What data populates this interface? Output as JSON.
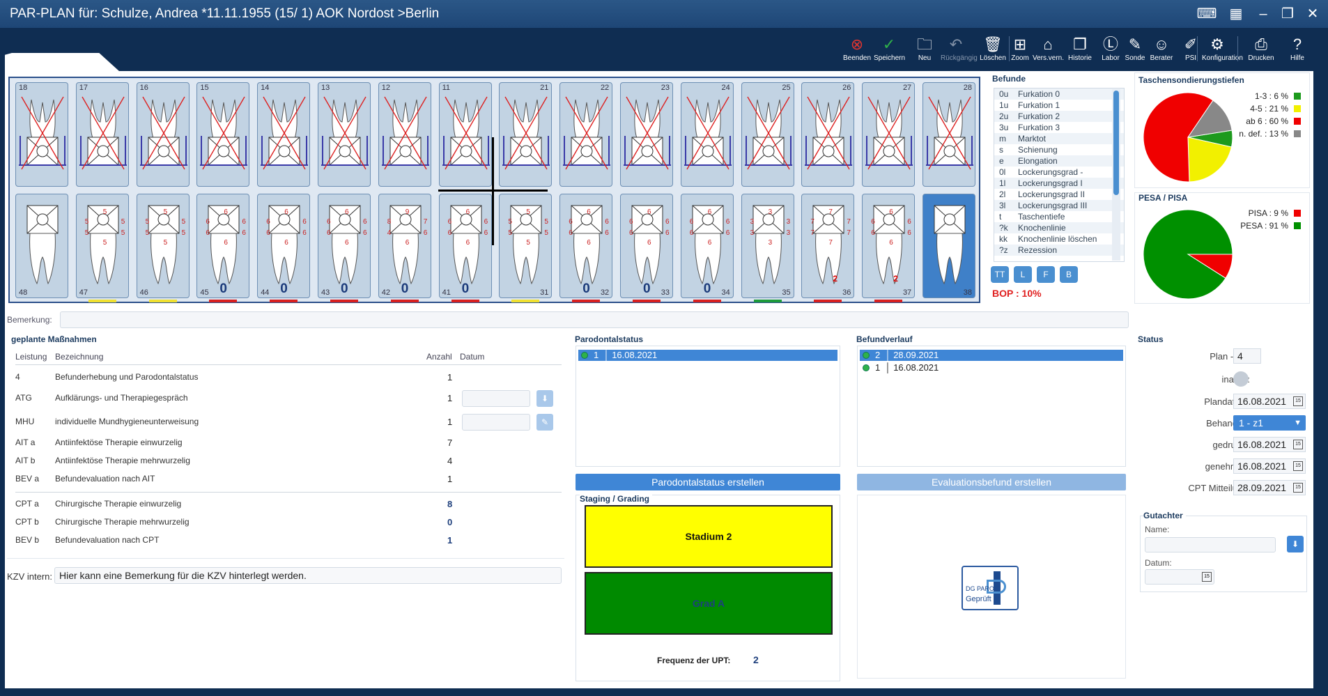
{
  "window": {
    "title": "PAR-PLAN für: Schulze, Andrea *11.11.1955 (15/  1) AOK Nordost >Berlin"
  },
  "toolbar": [
    {
      "label": "Beenden",
      "icon": "close-circle-icon",
      "color": "#e0342f"
    },
    {
      "label": "Speichern",
      "icon": "check-circle-icon",
      "color": "#2fb24a"
    },
    {
      "label": "Neu",
      "icon": "new-folder-icon",
      "color": "#ffffff"
    },
    {
      "label": "Rückgängig",
      "icon": "undo-icon",
      "color": "#7f8fa5"
    },
    {
      "label": "Löschen",
      "icon": "trash-icon",
      "color": "#ffffff"
    },
    {
      "label": "Zoom",
      "icon": "zoom-icon",
      "color": "#ffffff"
    },
    {
      "label": "Vers.vern.",
      "icon": "tag-icon",
      "color": "#ffffff"
    },
    {
      "label": "Historie",
      "icon": "copy-icon",
      "color": "#ffffff"
    },
    {
      "label": "Labor",
      "icon": "labor-icon",
      "color": "#ffffff"
    },
    {
      "label": "Sonde",
      "icon": "probe-icon",
      "color": "#ffffff"
    },
    {
      "label": "Berater",
      "icon": "user-gear-icon",
      "color": "#ffffff"
    },
    {
      "label": "PSI",
      "icon": "pencil-icon",
      "color": "#ffffff"
    },
    {
      "label": "Konfiguration",
      "icon": "gear-icon",
      "color": "#ffffff"
    },
    {
      "label": "Drucken",
      "icon": "printer-icon",
      "color": "#ffffff"
    },
    {
      "label": "Hilfe",
      "icon": "help-icon",
      "color": "#ffffff"
    }
  ],
  "teeth_upper": [
    {
      "num": "18",
      "xed": true,
      "bar": ""
    },
    {
      "num": "17",
      "xed": true,
      "bar": ""
    },
    {
      "num": "16",
      "xed": true,
      "bar": ""
    },
    {
      "num": "15",
      "xed": true,
      "bar": ""
    },
    {
      "num": "14",
      "xed": true,
      "bar": ""
    },
    {
      "num": "13",
      "xed": true,
      "bar": ""
    },
    {
      "num": "12",
      "xed": true,
      "bar": ""
    },
    {
      "num": "11",
      "xed": true,
      "bar": ""
    },
    {
      "num": "21",
      "xed": true,
      "bar": ""
    },
    {
      "num": "22",
      "xed": true,
      "bar": ""
    },
    {
      "num": "23",
      "xed": true,
      "bar": ""
    },
    {
      "num": "24",
      "xed": true,
      "bar": ""
    },
    {
      "num": "25",
      "xed": true,
      "bar": ""
    },
    {
      "num": "26",
      "xed": true,
      "bar": ""
    },
    {
      "num": "27",
      "xed": true,
      "bar": ""
    },
    {
      "num": "28",
      "xed": true,
      "bar": ""
    }
  ],
  "teeth_lower": [
    {
      "num": "48",
      "vals": [],
      "big": "",
      "extra": "",
      "bar": "",
      "sel": false
    },
    {
      "num": "47",
      "vals": [
        "5",
        "5",
        "5",
        "5",
        "5",
        "5"
      ],
      "big": "",
      "extra": "",
      "bar": "#f0e030",
      "sel": false
    },
    {
      "num": "46",
      "vals": [
        "5",
        "5",
        "5",
        "5",
        "5",
        "5"
      ],
      "big": "",
      "extra": "",
      "bar": "#f0e030",
      "sel": false
    },
    {
      "num": "45",
      "vals": [
        "6",
        "6",
        "6",
        "6",
        "6",
        "6"
      ],
      "big": "0",
      "extra": "",
      "bar": "#d82020",
      "sel": false
    },
    {
      "num": "44",
      "vals": [
        "6",
        "6",
        "6",
        "6",
        "6",
        "6"
      ],
      "big": "0",
      "extra": "",
      "bar": "#d82020",
      "sel": false
    },
    {
      "num": "43",
      "vals": [
        "6",
        "6",
        "6",
        "6",
        "6",
        "6"
      ],
      "big": "0",
      "extra": "",
      "bar": "#d82020",
      "sel": false
    },
    {
      "num": "42",
      "vals": [
        "9",
        "8",
        "7",
        "4",
        "6",
        "6"
      ],
      "big": "0",
      "extra": "",
      "bar": "#d82020",
      "sel": false
    },
    {
      "num": "41",
      "vals": [
        "6",
        "6",
        "6",
        "6",
        "6",
        "6"
      ],
      "big": "0",
      "extra": "",
      "bar": "#d82020",
      "sel": false
    },
    {
      "num": "31",
      "vals": [
        "5",
        "5",
        "5",
        "5",
        "5",
        "5"
      ],
      "big": "",
      "extra": "",
      "bar": "#f0e030",
      "sel": false
    },
    {
      "num": "32",
      "vals": [
        "6",
        "6",
        "6",
        "6",
        "6",
        "6"
      ],
      "big": "0",
      "extra": "",
      "bar": "#d82020",
      "sel": false
    },
    {
      "num": "33",
      "vals": [
        "6",
        "6",
        "6",
        "6",
        "6",
        "6"
      ],
      "big": "0",
      "extra": "",
      "bar": "#d82020",
      "sel": false
    },
    {
      "num": "34",
      "vals": [
        "6",
        "6",
        "6",
        "6",
        "6",
        "6"
      ],
      "big": "0",
      "extra": "",
      "bar": "#d82020",
      "sel": false
    },
    {
      "num": "35",
      "vals": [
        "3",
        "3",
        "3",
        "3",
        "3",
        "3"
      ],
      "big": "",
      "extra": "",
      "bar": "#1d9a3a",
      "sel": false
    },
    {
      "num": "36",
      "vals": [
        "7",
        "7",
        "7",
        "7",
        "7",
        "7"
      ],
      "big": "",
      "extra": "2",
      "bar": "#d82020",
      "sel": false
    },
    {
      "num": "37",
      "vals": [
        "6",
        "6",
        "6",
        "6",
        "6",
        "6"
      ],
      "big": "",
      "extra": "2",
      "bar": "#d82020",
      "sel": false
    },
    {
      "num": "38",
      "vals": [],
      "big": "",
      "extra": "",
      "bar": "",
      "sel": true
    }
  ],
  "befunde": {
    "title": "Befunde",
    "items": [
      {
        "code": "0u",
        "text": "Furkation  0"
      },
      {
        "code": "1u",
        "text": "Furkation  1"
      },
      {
        "code": "2u",
        "text": "Furkation  2"
      },
      {
        "code": "3u",
        "text": "Furkation  3"
      },
      {
        "code": "m",
        "text": "Marktot"
      },
      {
        "code": "s",
        "text": "Schienung"
      },
      {
        "code": "e",
        "text": "Elongation"
      },
      {
        "code": "0l",
        "text": "Lockerungsgrad -"
      },
      {
        "code": "1l",
        "text": "Lockerungsgrad I"
      },
      {
        "code": "2l",
        "text": "Lockerungsgrad II"
      },
      {
        "code": "3l",
        "text": "Lockerungsgrad III"
      },
      {
        "code": "t",
        "text": "Taschentiefe"
      },
      {
        "code": "?k",
        "text": "Knochenlinie"
      },
      {
        "code": "kk",
        "text": "Knochenlinie löschen"
      },
      {
        "code": "?z",
        "text": "Rezession"
      }
    ],
    "buttons": [
      "TT",
      "L",
      "F",
      "B"
    ],
    "bop": "BOP :  10%"
  },
  "tasche": {
    "title": "Taschensondierungstiefen",
    "legend": [
      {
        "label": "1-3 : 6 %",
        "color": "#1d9a1d"
      },
      {
        "label": "4-5 : 21 %",
        "color": "#f2f000"
      },
      {
        "label": "ab 6 : 60 %",
        "color": "#f00000"
      },
      {
        "label": "n. def. : 13 %",
        "color": "#888888"
      }
    ]
  },
  "pesa": {
    "title": "PESA / PISA",
    "legend": [
      {
        "label": "PISA : 9 %",
        "color": "#f00000"
      },
      {
        "label": "PESA : 91 %",
        "color": "#009000"
      }
    ]
  },
  "bemerkung_label": "Bemerkung:",
  "massnahmen": {
    "title": "geplante Maßnahmen",
    "headers": [
      "Leistung",
      "Bezeichnung",
      "Anzahl",
      "Datum"
    ],
    "rows": [
      {
        "code": "4",
        "name": "Befunderhebung und Parodontalstatus",
        "count": "1"
      },
      {
        "code": "ATG",
        "name": "Aufklärungs- und Therapiegespräch",
        "count": "1"
      },
      {
        "code": "MHU",
        "name": "individuelle Mundhygieneunterweisung",
        "count": "1"
      },
      {
        "code": "AIT a",
        "name": "Antiinfektöse Therapie einwurzelig",
        "count": "7"
      },
      {
        "code": "AIT b",
        "name": "Antiinfektöse Therapie mehrwurzelig",
        "count": "4"
      },
      {
        "code": "BEV a",
        "name": "Befundevaluation nach AIT",
        "count": "1"
      },
      {
        "code": "CPT a",
        "name": "Chirurgische Therapie einwurzelig",
        "count": "8"
      },
      {
        "code": "CPT b",
        "name": "Chirurgische Therapie mehrwurzelig",
        "count": "0"
      },
      {
        "code": "BEV b",
        "name": "Befundevaluation nach CPT",
        "count": "1"
      }
    ]
  },
  "kzv": {
    "label": "KZV intern:",
    "value": "Hier kann eine Bemerkung für die KZV hinterlegt werden."
  },
  "parostatus": {
    "title": "Parodontalstatus",
    "items": [
      {
        "nr": "1",
        "date": "16.08.2021"
      }
    ],
    "button": "Parodontalstatus erstellen"
  },
  "staging": {
    "title": "Staging / Grading",
    "stadium": "Stadium 2",
    "grad": "Grad A",
    "freq_label": "Frequenz der UPT:",
    "freq_value": "2"
  },
  "befundverlauf": {
    "title": "Befundverlauf",
    "items": [
      {
        "nr": "2",
        "date": "28.09.2021"
      },
      {
        "nr": "1",
        "date": "16.08.2021"
      }
    ],
    "button": "Evaluationsbefund erstellen",
    "logo_line1": "DG PARO",
    "logo_line2": "Geprüft"
  },
  "status": {
    "title": "Status",
    "plan_label": "Plan - Nr.:",
    "plan_value": "4",
    "inaktiv_label": "inaktiv:",
    "plandatum_label": "Plandatum:",
    "plandatum_value": "16.08.2021",
    "behandler_label": "Behandler:",
    "behandler_value": "1 - z1",
    "gedruckt_label": "gedruckt:",
    "gedruckt_value": "16.08.2021",
    "genehmigt_label": "genehmigt:",
    "genehmigt_value": "16.08.2021",
    "cpt_label": "CPT Mitteilung:",
    "cpt_value": "28.09.2021"
  },
  "gutachter": {
    "title": "Gutachter",
    "name_label": "Name:",
    "datum_label": "Datum:"
  }
}
